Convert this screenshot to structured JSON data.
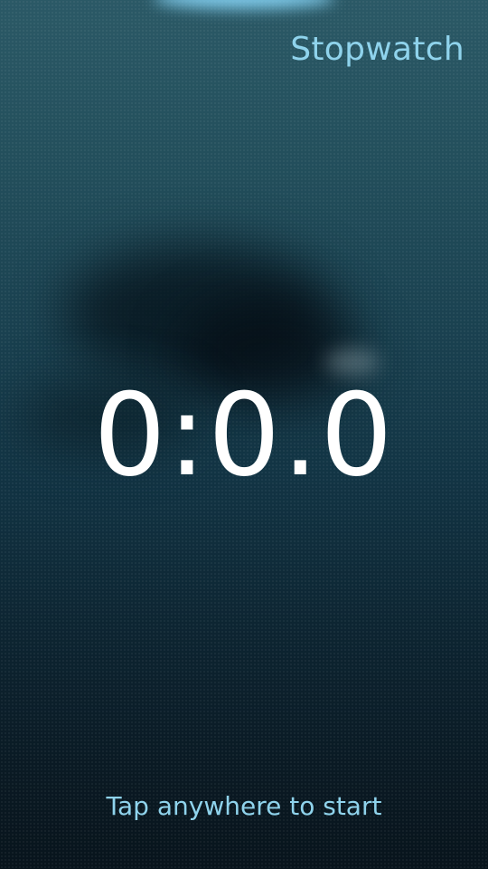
{
  "app": {
    "title": "Stopwatch"
  },
  "stopwatch": {
    "display": "0:0.0",
    "hint": "Tap anywhere to start"
  },
  "colors": {
    "accent": "#8fd3ec",
    "timer_text": "#ffffff",
    "background_top": "#2b5966",
    "background_bottom": "#08141c"
  }
}
